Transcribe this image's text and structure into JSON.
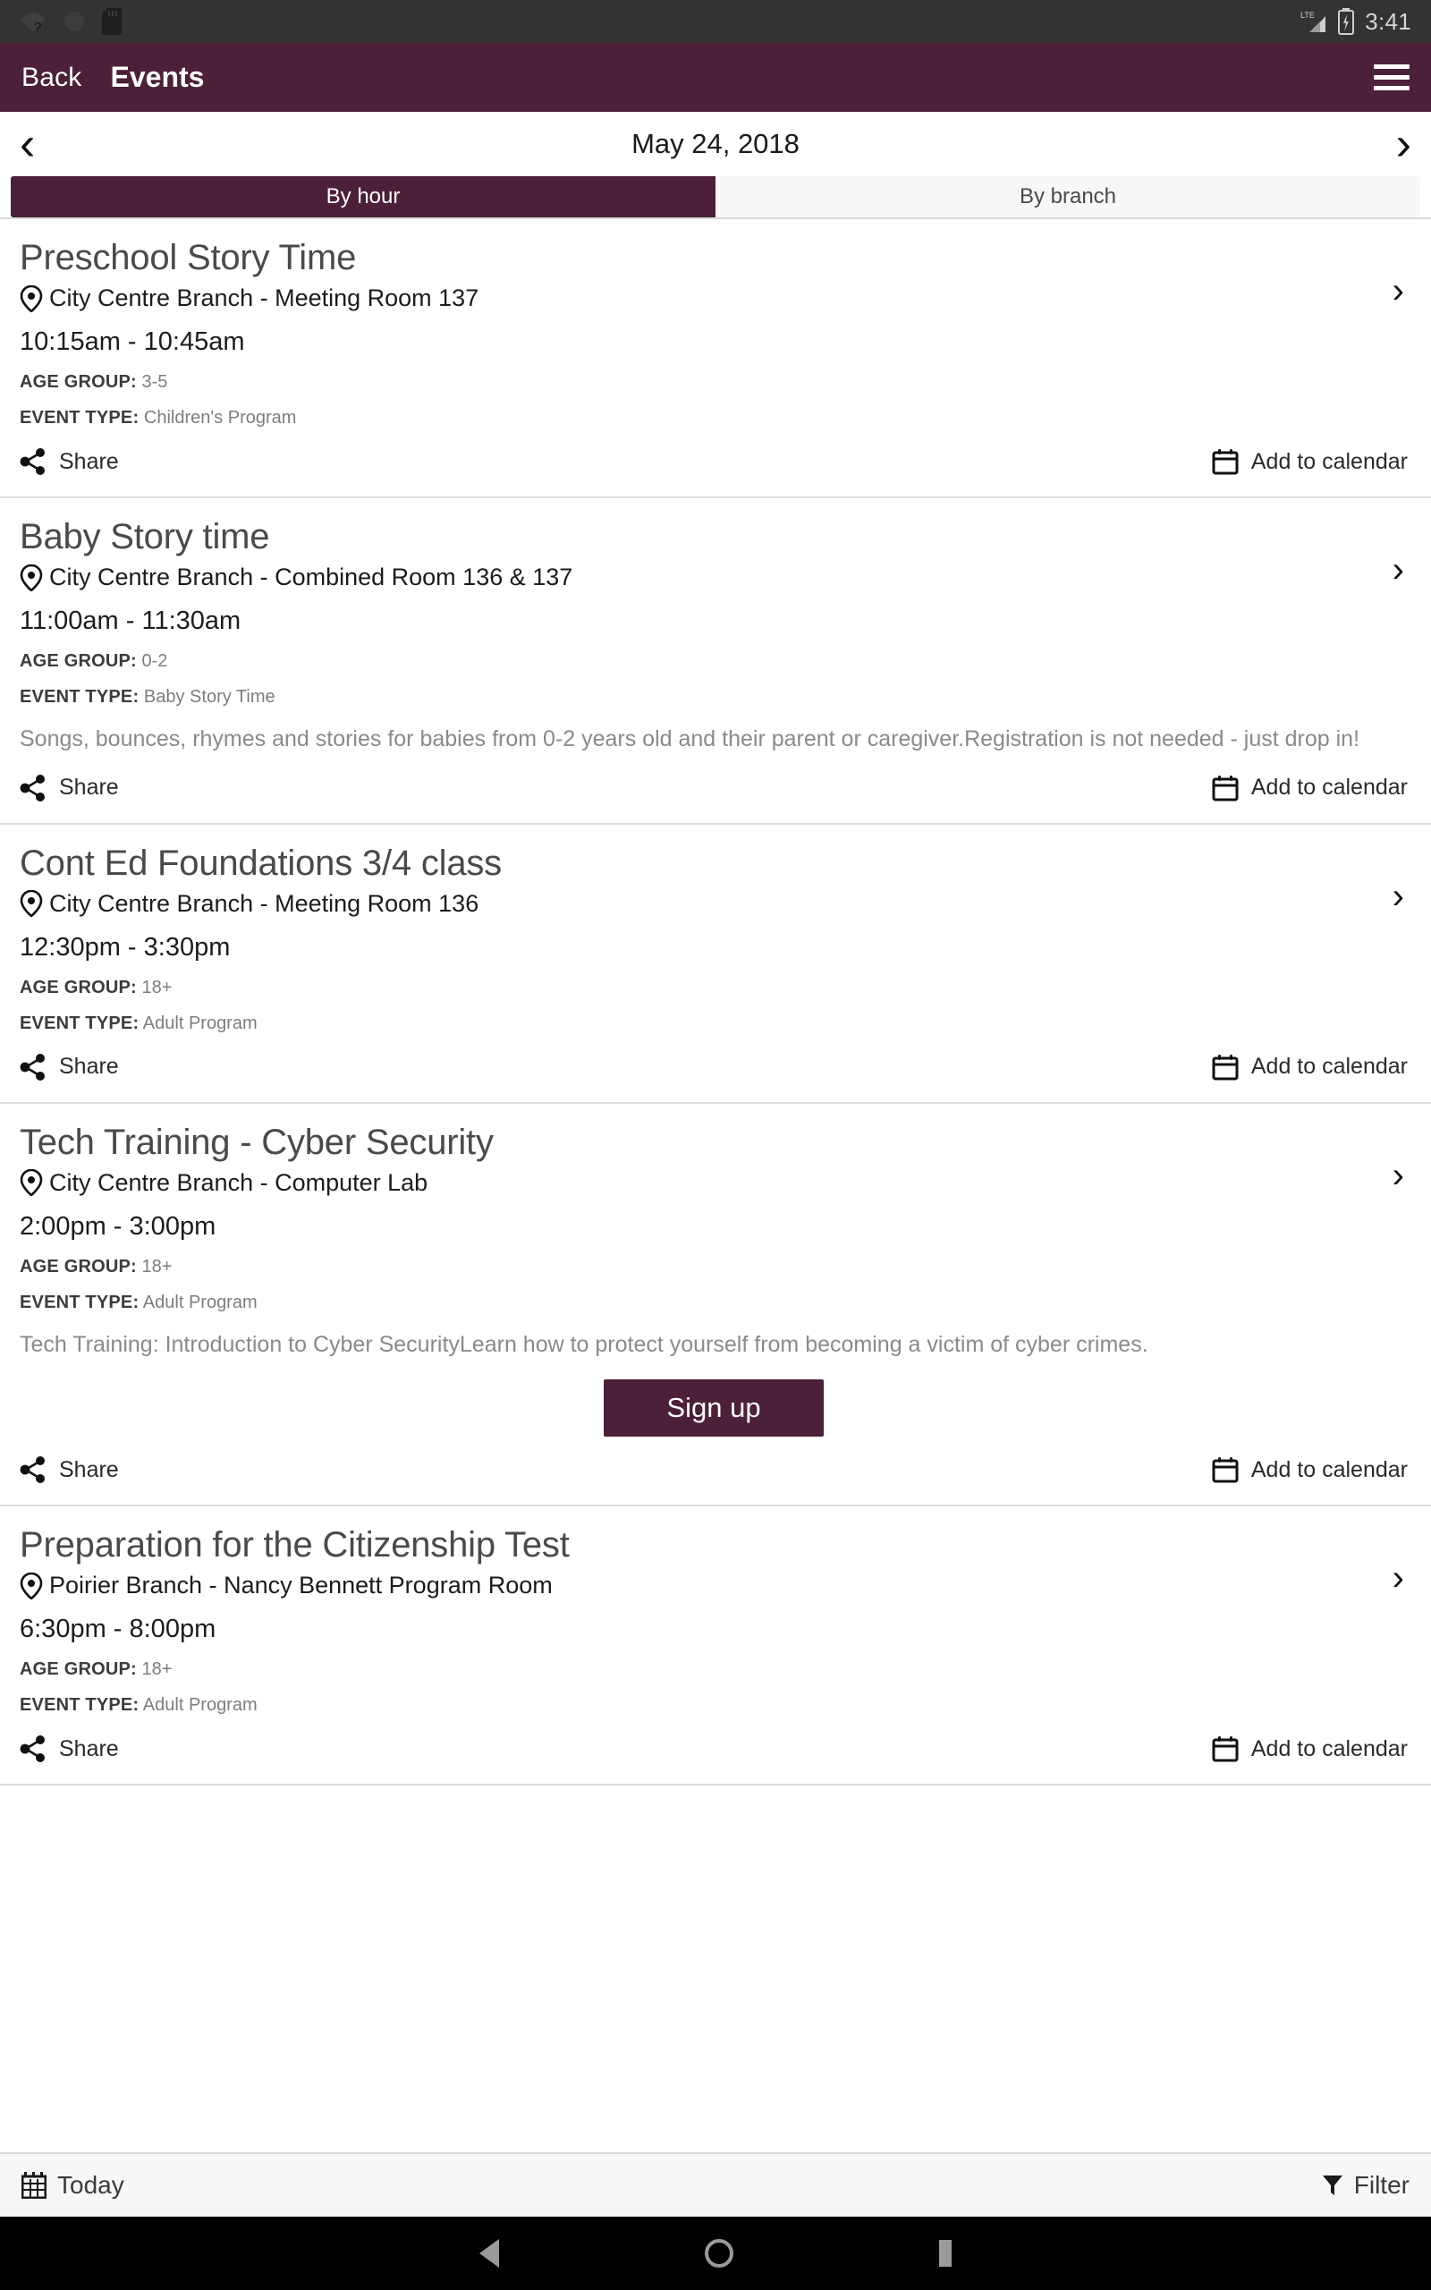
{
  "statusbar": {
    "time": "3:41",
    "icons": [
      "wifi-question-icon",
      "circle-icon",
      "sd-card-icon",
      "lte-signal-icon",
      "battery-icon"
    ]
  },
  "appbar": {
    "back_label": "Back",
    "title": "Events",
    "menu_icon": "hamburger-menu-icon"
  },
  "datenav": {
    "prev_icon": "‹",
    "date": "May 24, 2018",
    "next_icon": "›"
  },
  "tabs": [
    {
      "label": "By hour",
      "active": true
    },
    {
      "label": "By branch",
      "active": false
    }
  ],
  "labels": {
    "age_group": "AGE GROUP:",
    "event_type": "EVENT TYPE:",
    "share": "Share",
    "add_to_calendar": "Add to calendar",
    "signup": "Sign up",
    "chevron": "›"
  },
  "events": [
    {
      "title": "Preschool Story Time",
      "location": "City Centre Branch - Meeting Room 137",
      "time": "10:15am - 10:45am",
      "age_group": "3-5",
      "event_type": "Children's Program",
      "description": "",
      "signup": false
    },
    {
      "title": "Baby Story time",
      "location": "City Centre Branch - Combined Room 136 & 137",
      "time": "11:00am - 11:30am",
      "age_group": "0-2",
      "event_type": "Baby Story Time",
      "description": "Songs, bounces, rhymes and stories for babies from 0-2 years old and their parent or caregiver.Registration is not needed - just drop in!",
      "signup": false
    },
    {
      "title": "Cont Ed Foundations 3/4 class",
      "location": "City Centre Branch - Meeting Room 136",
      "time": "12:30pm - 3:30pm",
      "age_group": "18+",
      "event_type": "Adult Program",
      "description": "",
      "signup": false
    },
    {
      "title": "Tech Training - Cyber Security",
      "location": "City Centre Branch - Computer Lab",
      "time": "2:00pm - 3:00pm",
      "age_group": "18+",
      "event_type": "Adult Program",
      "description": "Tech Training: Introduction to Cyber SecurityLearn how to protect yourself from becoming a victim of cyber crimes.",
      "signup": true
    },
    {
      "title": "Preparation for the Citizenship Test",
      "location": "Poirier Branch - Nancy Bennett Program Room",
      "time": "6:30pm - 8:00pm",
      "age_group": "18+",
      "event_type": "Adult Program",
      "description": "",
      "signup": false
    }
  ],
  "bottombar": {
    "today_label": "Today",
    "today_icon": "calendar-icon",
    "filter_label": "Filter",
    "filter_icon": "funnel-icon"
  },
  "navbar": {
    "back_icon": "nav-back-triangle",
    "home_icon": "nav-home-circle",
    "recents_icon": "nav-recents-square"
  },
  "colors": {
    "brand": "#4B2038",
    "statusbar": "#333333",
    "inactive_tab": "#F7F7F7"
  }
}
